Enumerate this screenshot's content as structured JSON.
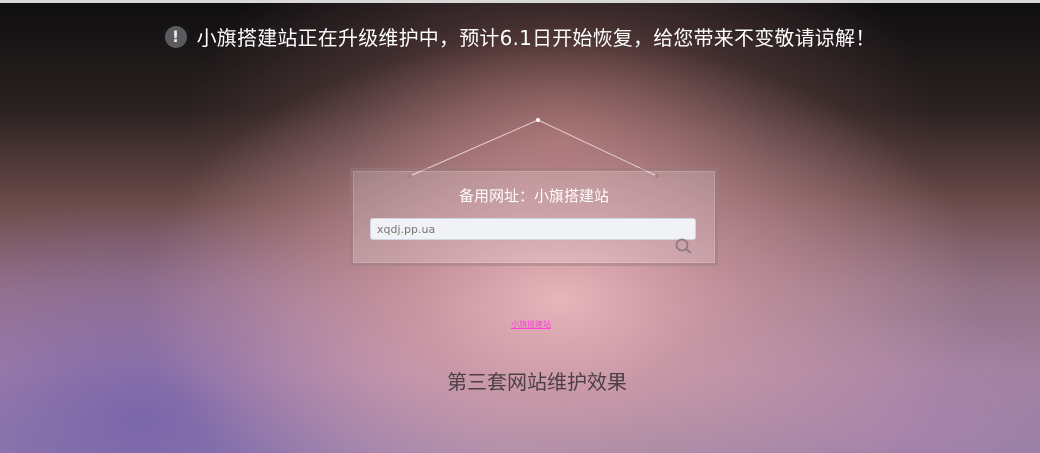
{
  "notice": {
    "icon": "exclamation-icon",
    "text": "小旗搭建站正在升级维护中，预计6.1日开始恢复，给您带来不变敬请谅解！"
  },
  "card": {
    "title": "备用网址：小旗搭建站",
    "search_placeholder": "xqdj.pp.ua",
    "search_icon": "magnifier-icon"
  },
  "link": {
    "text": "小旗搭建站"
  },
  "caption": {
    "text": "第三套网站维护效果"
  },
  "colors": {
    "notice_text": "#ffffff",
    "link": "#ff3fd8",
    "caption": "#4c3f44"
  }
}
